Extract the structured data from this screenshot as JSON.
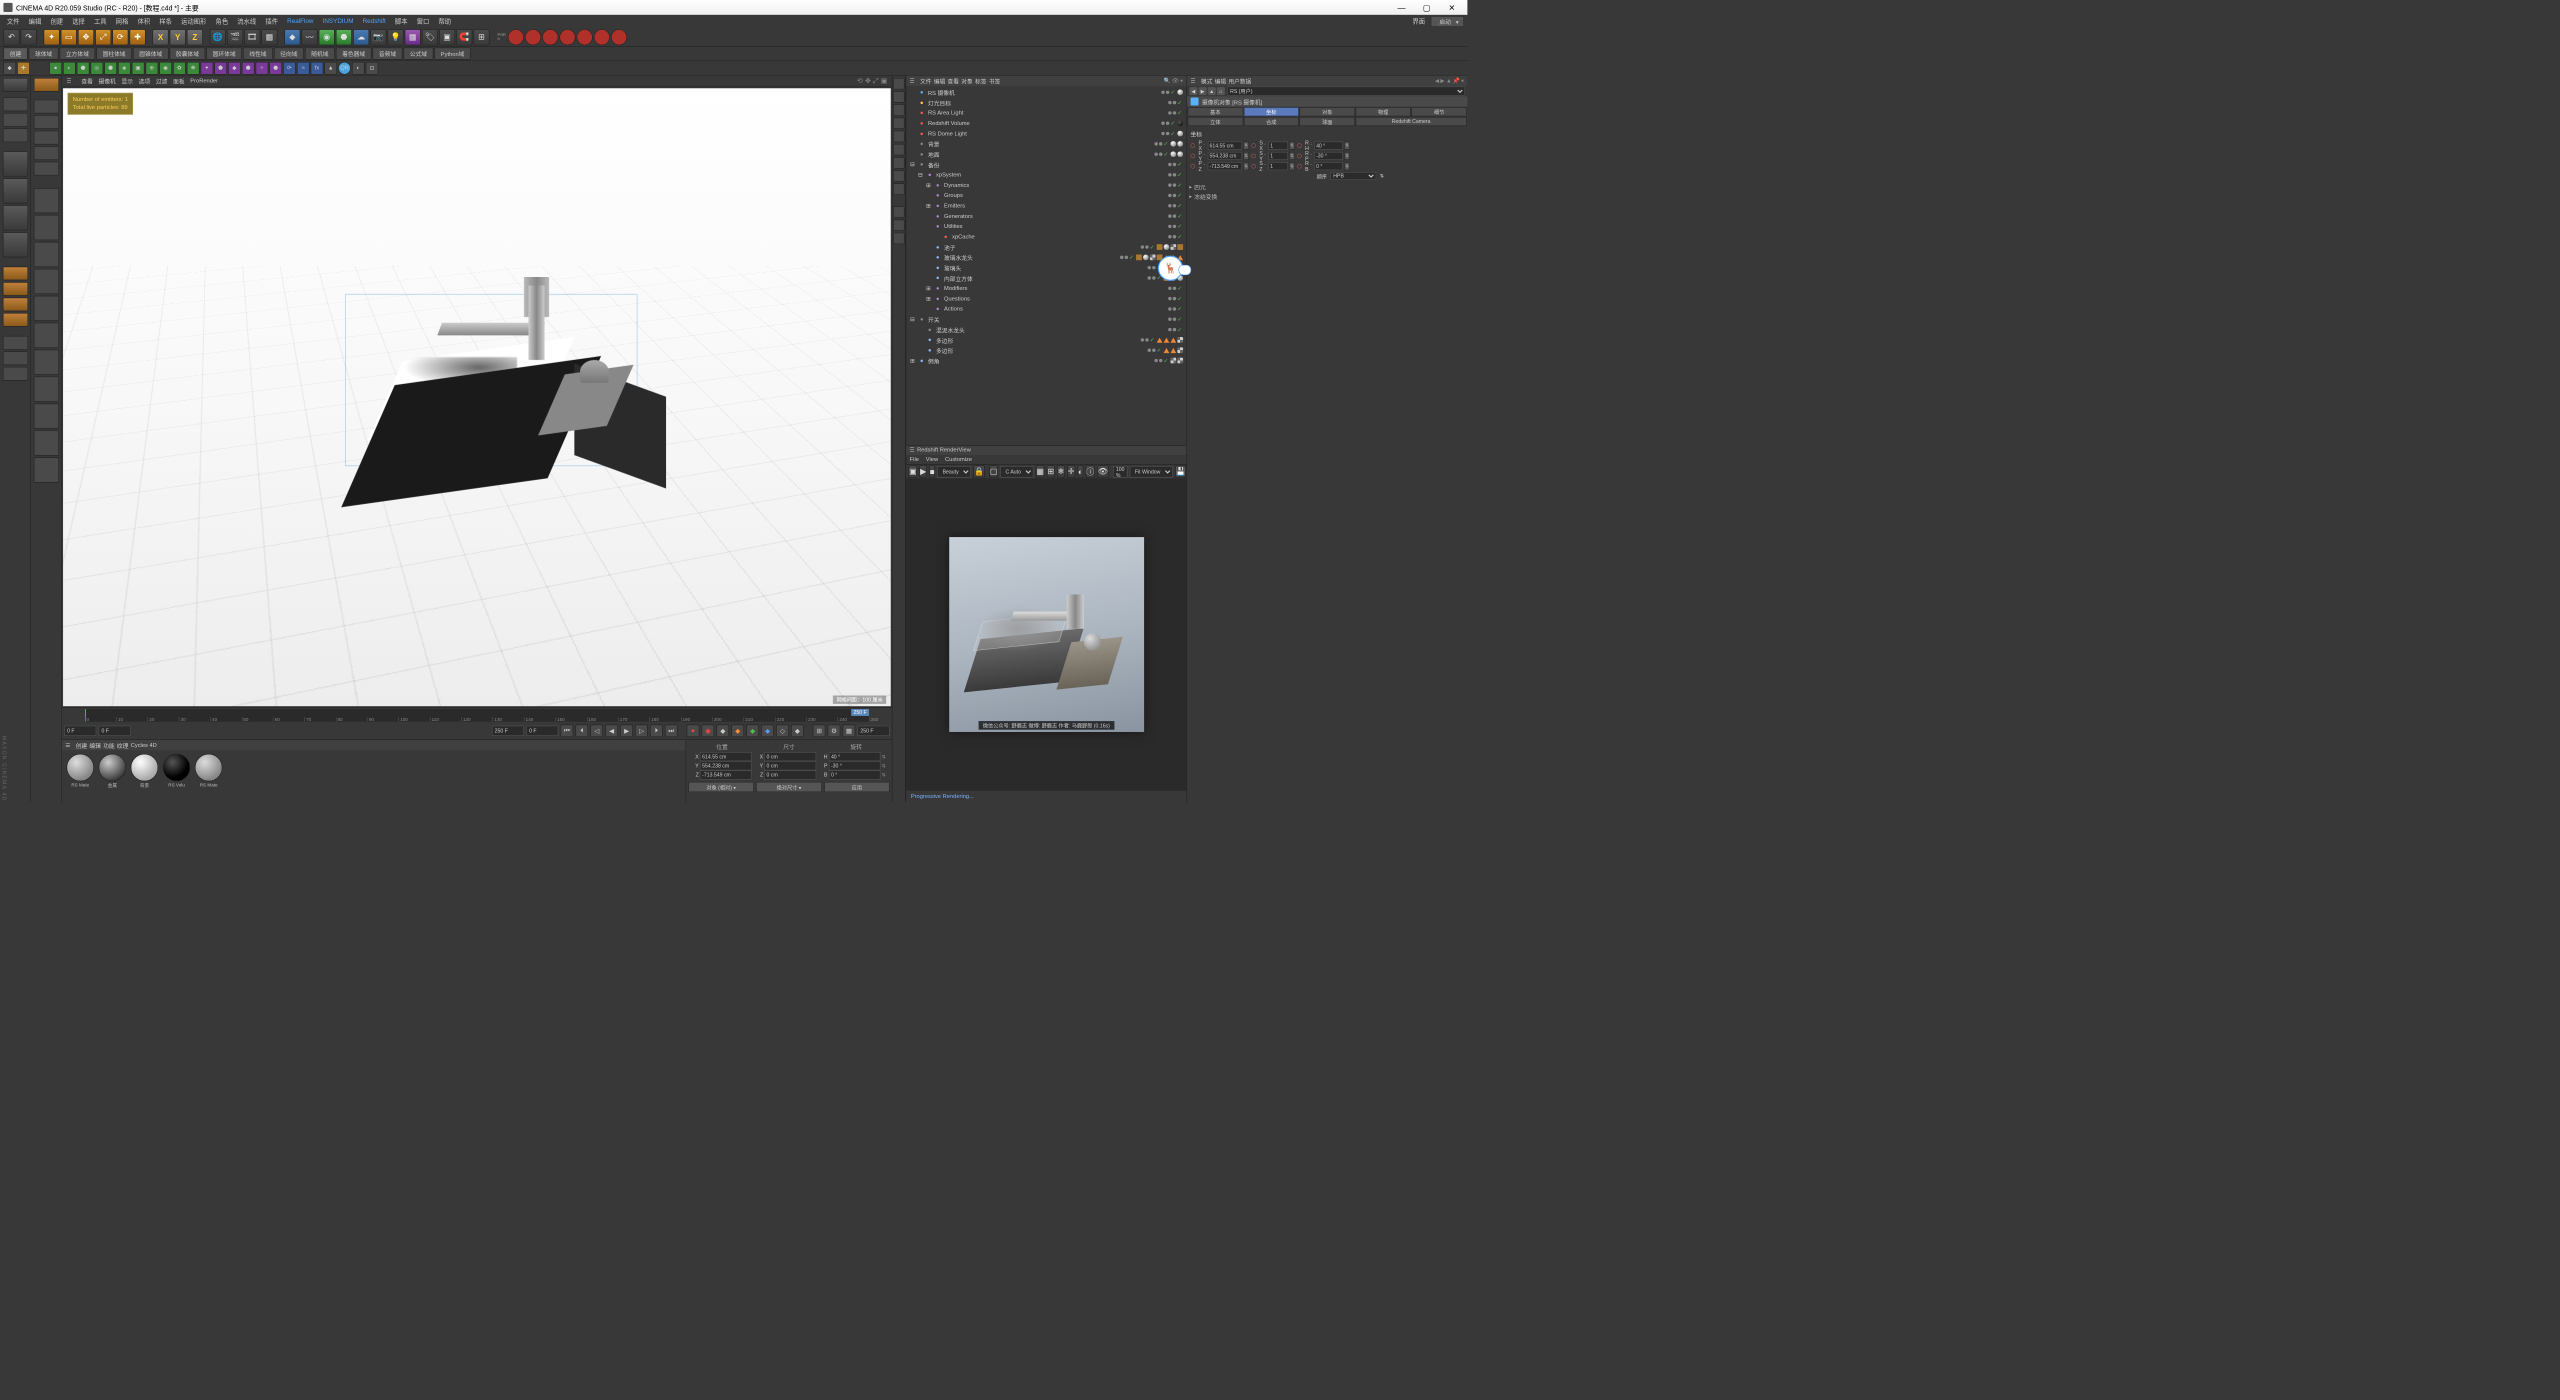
{
  "title": "CINEMA 4D R20.059 Studio (RC - R20) - [教程.c4d *] - 主要",
  "menus": [
    "文件",
    "编辑",
    "创建",
    "选择",
    "工具",
    "网格",
    "体积",
    "样条",
    "运动图形",
    "角色",
    "流水线",
    "插件",
    "RealFlow",
    "INSYDIUM",
    "Redshift",
    "脚本",
    "窗口",
    "帮助"
  ],
  "menu_right": {
    "layout_label": "界面",
    "layout_value": "启动"
  },
  "palette_tabs": [
    "创建",
    "球体域",
    "立方体域",
    "圆柱体域",
    "圆锥体域",
    "胶囊体域",
    "圆环体域",
    "线性域",
    "径向域",
    "随机域",
    "着色器域",
    "音频域",
    "公式域",
    "Python域"
  ],
  "vp": {
    "menu": [
      "查看",
      "摄像机",
      "显示",
      "选项",
      "过滤",
      "面板",
      "ProRender"
    ],
    "overlay_line1": "Number of emitters: 1",
    "overlay_line2": "Total live particles: 89",
    "status": "网格间距：100 厘米"
  },
  "timeline": {
    "start": "0 F",
    "startfield": "0 F",
    "end": "250 F",
    "endfield": "250 F",
    "ticks": [
      0,
      10,
      20,
      30,
      40,
      50,
      60,
      70,
      80,
      90,
      100,
      110,
      120,
      130,
      140,
      150,
      160,
      170,
      180,
      190,
      200,
      210,
      220,
      230,
      240,
      250
    ],
    "cur": "0 F"
  },
  "materials": {
    "tabs": [
      "创建",
      "编辑",
      "功能",
      "纹理",
      "Cycles 4D"
    ],
    "items": [
      {
        "name": "RS Mate",
        "cls": "cloud"
      },
      {
        "name": "金属",
        "cls": ""
      },
      {
        "name": "背景",
        "cls": "white"
      },
      {
        "name": "RS Volu",
        "cls": "black"
      },
      {
        "name": "RS Mate",
        "cls": "cloud"
      }
    ]
  },
  "coords": {
    "header": [
      "位置",
      "尺寸",
      "旋转"
    ],
    "rows": [
      {
        "a": "X",
        "av": "614.55 cm",
        "b": "X",
        "bv": "0 cm",
        "c": "H",
        "cv": "40 °"
      },
      {
        "a": "Y",
        "av": "554.238 cm",
        "b": "Y",
        "bv": "0 cm",
        "c": "P",
        "cv": "-30 °"
      },
      {
        "a": "Z",
        "av": "-713.549 cm",
        "b": "Z",
        "bv": "0 cm",
        "c": "B",
        "cv": "0 °"
      }
    ],
    "buttons": [
      "对象 (相对)",
      "绝对尺寸",
      "应用"
    ]
  },
  "objmgr": {
    "tabs": [
      "文件",
      "编辑",
      "查看",
      "对象",
      "标签",
      "书签"
    ],
    "tree": [
      {
        "d": 0,
        "exp": "",
        "ico": "cam",
        "name": "RS 摄像机",
        "tags": [
          "dot",
          "chk",
          "ball-white"
        ]
      },
      {
        "d": 0,
        "exp": "",
        "ico": "light",
        "name": "灯光目标",
        "tags": [
          "dot",
          "chk"
        ]
      },
      {
        "d": 0,
        "exp": "",
        "ico": "rs",
        "name": "RS Area Light",
        "tags": [
          "dot",
          "chk"
        ]
      },
      {
        "d": 0,
        "exp": "",
        "ico": "rs",
        "name": "Redshift Volume",
        "tags": [
          "dot",
          "chk",
          "ball-dark"
        ]
      },
      {
        "d": 0,
        "exp": "",
        "ico": "rs",
        "name": "RS Dome Light",
        "tags": [
          "dot",
          "chk",
          "ball-white"
        ]
      },
      {
        "d": 0,
        "exp": "",
        "ico": "null",
        "name": "背景",
        "tags": [
          "dot",
          "chk",
          "ball-white",
          "ball-white"
        ]
      },
      {
        "d": 0,
        "exp": "",
        "ico": "null",
        "name": "地面",
        "tags": [
          "dot",
          "chk",
          "ball-white",
          "ball-white"
        ]
      },
      {
        "d": 0,
        "exp": "⊟",
        "ico": "null",
        "name": "备份",
        "tags": [
          "dot",
          "chk"
        ]
      },
      {
        "d": 1,
        "exp": "⊟",
        "ico": "xp",
        "name": "xpSystem",
        "tags": [
          "dot",
          "chk"
        ]
      },
      {
        "d": 2,
        "exp": "⊞",
        "ico": "xp",
        "name": "Dynamics",
        "tags": [
          "dot",
          "chk"
        ]
      },
      {
        "d": 2,
        "exp": "",
        "ico": "xp",
        "name": "Groups",
        "tags": [
          "dot",
          "chk"
        ]
      },
      {
        "d": 2,
        "exp": "⊞",
        "ico": "xp",
        "name": "Emitters",
        "tags": [
          "dot",
          "chk"
        ]
      },
      {
        "d": 2,
        "exp": "",
        "ico": "xp",
        "name": "Generators",
        "tags": [
          "dot",
          "chk"
        ]
      },
      {
        "d": 2,
        "exp": "",
        "ico": "xp",
        "name": "Utilities",
        "tags": [
          "dot",
          "chk"
        ]
      },
      {
        "d": 3,
        "exp": "",
        "ico": "rs",
        "name": "xpCache",
        "tags": [
          "dot",
          "chk"
        ]
      },
      {
        "d": 2,
        "exp": "",
        "ico": "poly",
        "name": "池子",
        "tags": [
          "dot",
          "chk",
          "sq",
          "ball",
          "dots",
          "sq"
        ]
      },
      {
        "d": 2,
        "exp": "",
        "ico": "poly",
        "name": "玻璃水龙头",
        "tags": [
          "dot",
          "chk",
          "sq",
          "ball",
          "dots",
          "sq",
          "tri",
          "tri",
          "tri"
        ]
      },
      {
        "d": 2,
        "exp": "",
        "ico": "poly",
        "name": "玻璃头",
        "tags": [
          "dot",
          "chk",
          "sq",
          "ball",
          "dots"
        ]
      },
      {
        "d": 2,
        "exp": "",
        "ico": "poly",
        "name": "内部立方体",
        "tags": [
          "dot",
          "chk",
          "sq",
          "ball",
          "ball"
        ]
      },
      {
        "d": 2,
        "exp": "⊞",
        "ico": "xp",
        "name": "Modifiers",
        "tags": [
          "dot",
          "chk"
        ]
      },
      {
        "d": 2,
        "exp": "⊞",
        "ico": "xp",
        "name": "Questions",
        "tags": [
          "dot",
          "chk"
        ]
      },
      {
        "d": 2,
        "exp": "",
        "ico": "xp",
        "name": "Actions",
        "tags": [
          "dot",
          "chk"
        ]
      },
      {
        "d": 0,
        "exp": "⊟",
        "ico": "null",
        "name": "开关",
        "tags": [
          "dot",
          "chk"
        ]
      },
      {
        "d": 1,
        "exp": "",
        "ico": "null",
        "name": "混泥水龙头",
        "tags": [
          "dot",
          "chk"
        ]
      },
      {
        "d": 1,
        "exp": "",
        "ico": "poly",
        "name": "多边形",
        "tags": [
          "dot",
          "chk",
          "tri",
          "tri",
          "tri",
          "dots"
        ]
      },
      {
        "d": 1,
        "exp": "",
        "ico": "poly",
        "name": "多边形",
        "tags": [
          "dot",
          "chk",
          "tri",
          "tri",
          "dots"
        ]
      },
      {
        "d": 0,
        "exp": "⊞",
        "ico": "poly",
        "name": "倒角",
        "tags": [
          "dot",
          "chk",
          "dots",
          "dots"
        ]
      }
    ]
  },
  "attrs": {
    "panel_tabs": [
      "模式",
      "编辑",
      "用户数据"
    ],
    "mode_select": "RS (用户)",
    "obj_title": "摄像机对象 [RS 摄像机]",
    "tabs1": [
      "基本",
      "坐标",
      "对象",
      "物理",
      "细节"
    ],
    "tabs2": [
      "立体",
      "合成",
      "球面",
      "Redshift Camera",
      ""
    ],
    "active_tab": "坐标",
    "section": "坐标",
    "rows": [
      {
        "l1": "P . X",
        "v1": "614.55 cm",
        "l2": "S . X",
        "v2": "1",
        "l3": "R . H",
        "v3": "40 °"
      },
      {
        "l1": "P . Y",
        "v1": "554.238 cm",
        "l2": "S . Y",
        "v2": "1",
        "l3": "R . P",
        "v3": "-30 °"
      },
      {
        "l1": "P . Z",
        "v1": "-713.549 cm",
        "l2": "S . Z",
        "v2": "1",
        "l3": "R . B",
        "v3": "0 °"
      }
    ],
    "rot_label": "顺序",
    "rot_value": "HPB",
    "collapsed": [
      "四元",
      "冻结变换"
    ]
  },
  "render": {
    "title": "Redshift RenderView",
    "menu": [
      "File",
      "View",
      "Customize"
    ],
    "beauty": "Beauty",
    "auto": "C Auto",
    "zoom": "100 %",
    "fit": "Fit Window",
    "caption": "微信公众号: 野鹿志   微博: 野鹿志   作者: 马鹿野郎  (0.16s)",
    "status": "Progressive Rendering..."
  },
  "watermark": "MAXON  CINEMA 4D"
}
